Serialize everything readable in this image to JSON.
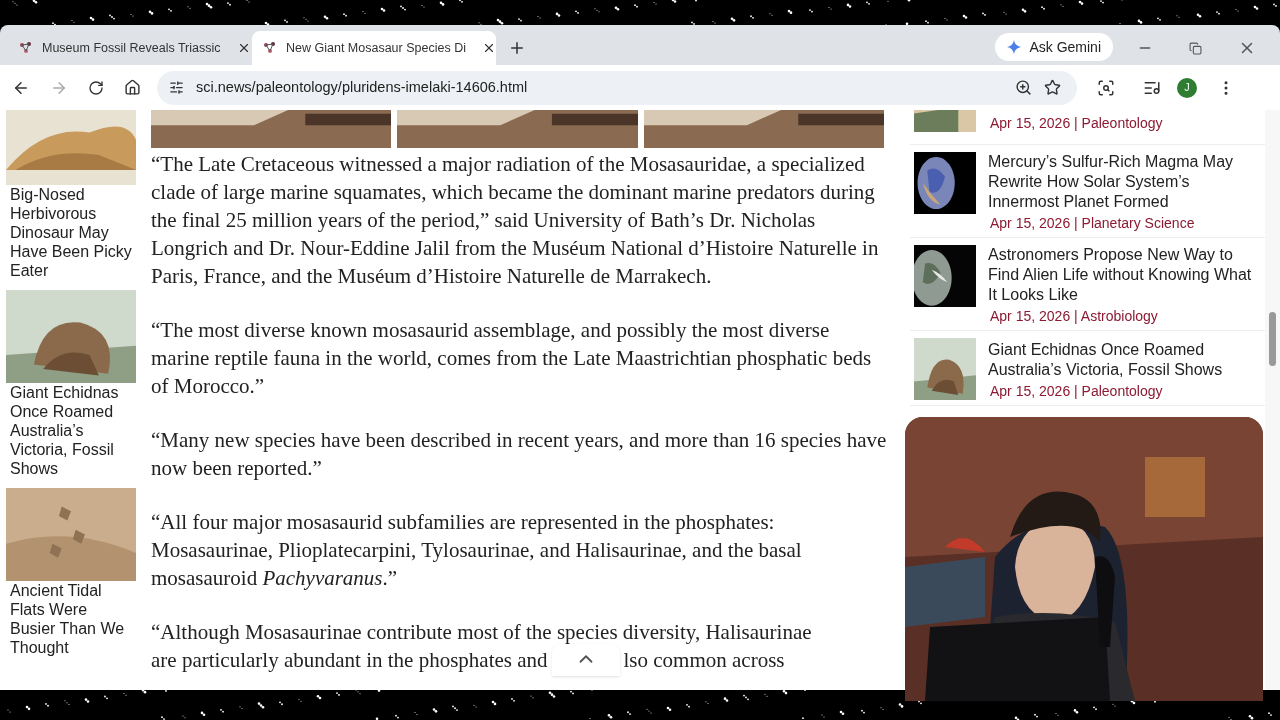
{
  "tabs": [
    {
      "title": "Museum Fossil Reveals Triassic",
      "selected": false
    },
    {
      "title": "New Giant Mosasaur Species Di",
      "selected": true
    }
  ],
  "ask_button": "Ask Gemini",
  "address": "sci.news/paleontology/pluridens-imelaki-14606.html",
  "profile_initial": "J",
  "left_column": [
    {
      "caption": "Big-Nosed Herbivorous Dinosaur May Have Been Picky Eater"
    },
    {
      "caption": "Giant Echidnas Once Roamed Australia’s Victoria, Fossil Shows"
    },
    {
      "caption": "Ancient Tidal Flats Were Busier Than We Thought"
    }
  ],
  "article": {
    "paragraphs": [
      "“The Late Cretaceous witnessed a major radiation of the Mosasauridae, a specialized clade of large marine squamates, which became the dominant marine predators during the final 25 million years of the period,” said University of Bath’s Dr. Nicholas Longrich and Dr. Nour-Eddine Jalil from the Muséum National d’Histoire Naturelle in Paris, France, and the Muséum d’Histoire Naturelle de Marrakech.",
      "“The most diverse known mosasaurid assemblage, and possibly the most diverse marine reptile fauna in the world, comes from the Late Maastrichtian phosphatic beds of Morocco.”",
      "“Many new species have been described in recent years, and more than 16 species have now been reported.”",
      "“All four major mosasaurid subfamilies are represented in the phosphates: Mosasaurinae, Plioplatecarpini, Tylosaurinae, and Halisaurinae, and the basal mosasauroid *Pachyvaranus*.”"
    ],
    "last_lines": [
      "“Although Mosasaurinae contribute most of the species diversity, Halisaurinae",
      "are particularly abundant in the phosphates and",
      "lso common across"
    ]
  },
  "sidebar": [
    {
      "meta": "Apr 15, 2026 | Paleontology"
    },
    {
      "title": "Mercury’s Sulfur-Rich Magma May Rewrite How Solar System’s Innermost Planet Formed",
      "meta": "Apr 15, 2026 | Planetary Science"
    },
    {
      "title": "Astronomers Propose New Way to Find Alien Life without Knowing What It Looks Like",
      "meta": "Apr 15, 2026 | Astrobiology"
    },
    {
      "title": "Giant Echidnas Once Roamed Australia’s Victoria, Fossil Shows",
      "meta": "Apr 15, 2026 | Paleontology"
    }
  ]
}
